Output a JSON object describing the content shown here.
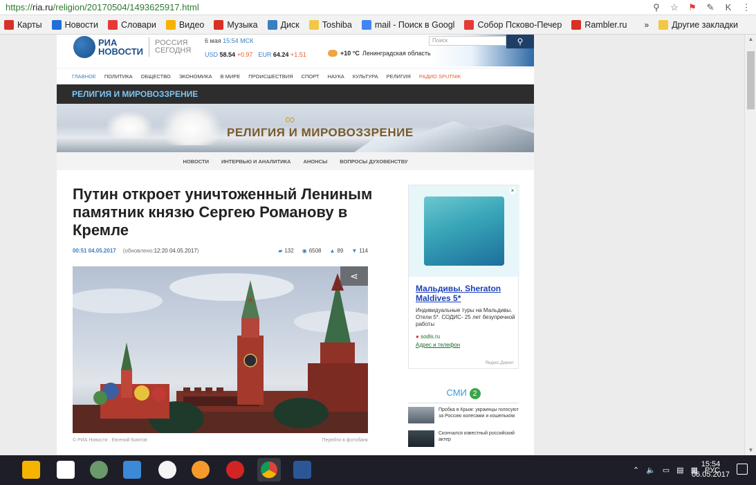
{
  "browser": {
    "url_scheme": "https://",
    "url_host": "ria.ru",
    "url_path": "/religion/20170504/1493625917.html",
    "bookmarks": [
      {
        "label": "Карты",
        "color": "#d93025"
      },
      {
        "label": "Новости",
        "color": "#1e6fd9"
      },
      {
        "label": "Словари",
        "color": "#e53935"
      },
      {
        "label": "Видео",
        "color": "#f4b400"
      },
      {
        "label": "Музыка",
        "color": "#d93025"
      },
      {
        "label": "Диск",
        "color": "#3a7fc1"
      },
      {
        "label": "Toshiba",
        "color": "#f2c744"
      },
      {
        "label": "mail - Поиск в Googl",
        "color": "#4285f4"
      },
      {
        "label": "Собор Псково-Печер",
        "color": "#e53935"
      },
      {
        "label": "Rambler.ru",
        "color": "#d93025"
      }
    ],
    "more": "»",
    "other_bookmarks": "Другие закладки"
  },
  "site": {
    "logo_main": "РИА\nНОВОСТИ",
    "logo_sub": "РОССИЯ\nСЕГОДНЯ",
    "date": "6 мая",
    "time": "15:54 МСК",
    "usd_label": "USD",
    "usd_value": "58.54",
    "usd_change": "+0.97",
    "eur_label": "EUR",
    "eur_value": "64.24",
    "eur_change": "+1.51",
    "weather": "+10 °C",
    "region": "Ленинградская область",
    "search_placeholder": "Поиск",
    "nav": [
      "ГЛАВНОЕ",
      "ПОЛИТИКА",
      "ОБЩЕСТВО",
      "ЭКОНОМИКА",
      "В МИРЕ",
      "ПРОИСШЕСТВИЯ",
      "СПОРТ",
      "НАУКА",
      "КУЛЬТУРА",
      "РЕЛИГИЯ"
    ],
    "radio": "РАДИО SPUTNIK",
    "section": "РЕЛИГИЯ И МИРОВОЗЗРЕНИЕ",
    "banner_title": "РЕЛИГИЯ И МИРОВОЗЗРЕНИЕ",
    "subnav": [
      "НОВОСТИ",
      "ИНТЕРВЬЮ И АНАЛИТИКА",
      "АНОНСЫ",
      "ВОПРОСЫ ДУХОВЕНСТВУ"
    ]
  },
  "article": {
    "headline": "Путин откроет уничтоженный Лениным памятник князю Сергею Романову в Кремле",
    "published": "00:51 04.05.2017",
    "updated_prefix": "(обновлено: ",
    "updated": "12:20 04.05.2017",
    "updated_suffix": ")",
    "comments": "132",
    "views": "6508",
    "likes": "89",
    "dislikes": "114",
    "caption_left": "© РИА Новости . Евгений Биятов",
    "caption_right": "Перейти в фотобанк"
  },
  "ad": {
    "title": "Мальдивы. Sheraton Maldives 5*",
    "desc": "Индивидуальные туры на Мальдивы. Отели 5*. СОДИС- 25 лет безупречной работы",
    "link1": "sodis.ru",
    "link2": "Адрес и телефон",
    "provider": "Яндекс.Директ"
  },
  "smi": {
    "label": "СМИ",
    "num": "2",
    "items": [
      "Пробка в Крым: украинцы голосуют за Россию колесами и кошельком",
      "Скончался известный российский актер"
    ]
  },
  "taskbar": {
    "lang": "РУС",
    "time": "15:54",
    "date": "06.05.2017"
  }
}
